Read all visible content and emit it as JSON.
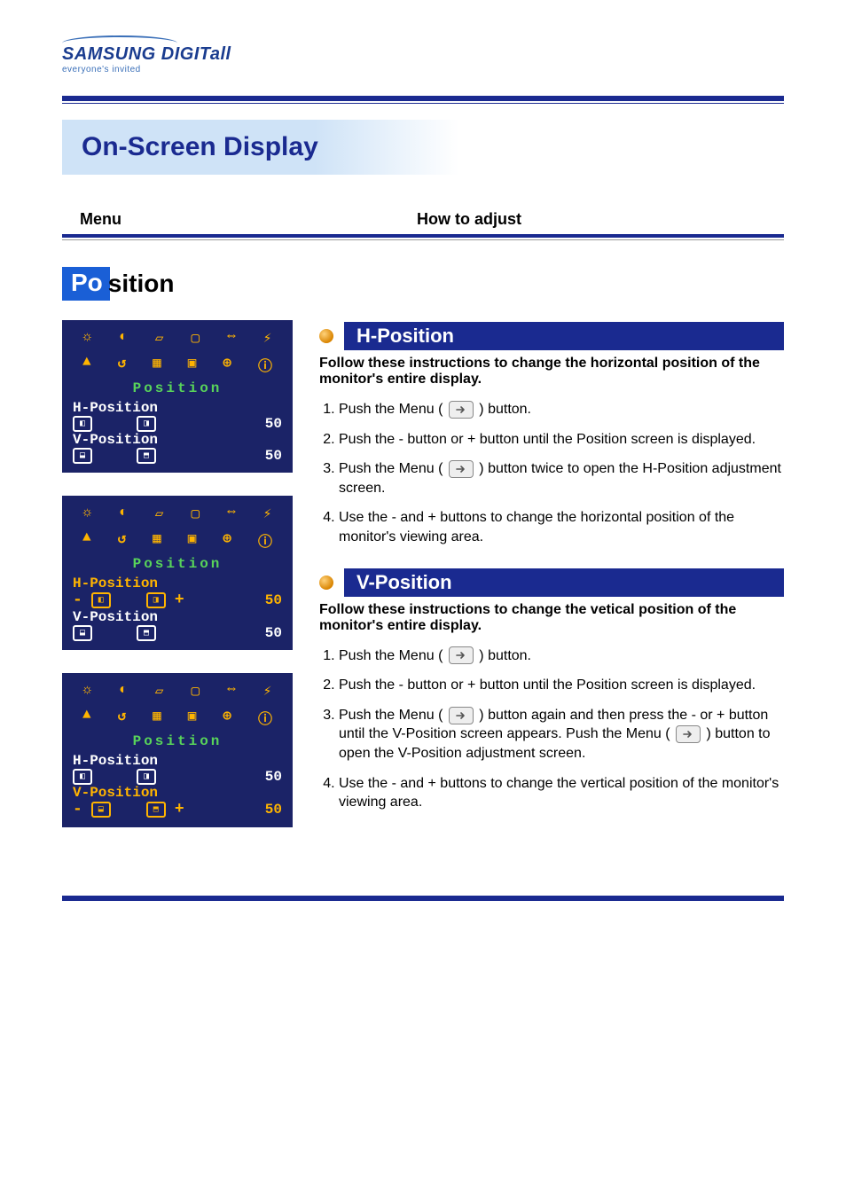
{
  "brand": {
    "name_main": "SAMSUNG DIGIT",
    "name_suffix": "all",
    "tagline": "everyone's invited"
  },
  "page_title": "On-Screen Display",
  "columns": {
    "menu": "Menu",
    "howto": "How to adjust"
  },
  "section": {
    "tab": "Po",
    "rest": "sition"
  },
  "osd": {
    "title": "Position",
    "h_label": "H-Position",
    "v_label": "V-Position",
    "h_value": "50",
    "v_value": "50"
  },
  "hpos": {
    "title": "H-Position",
    "lead": "Follow these instructions to change the horizontal position of the monitor's entire display.",
    "steps": [
      {
        "pre": "Push the Menu ( ",
        "post": " ) button."
      },
      {
        "text": "Push the - button or + button until the Position screen is displayed."
      },
      {
        "pre": "Push the Menu ( ",
        "post": " ) button twice to open the H-Position adjustment screen."
      },
      {
        "text": "Use the - and + buttons to change the horizontal position of the monitor's viewing area."
      }
    ]
  },
  "vpos": {
    "title": "V-Position",
    "lead": "Follow these instructions to change the vetical position of the monitor's entire display.",
    "steps": [
      {
        "pre": "Push the Menu ( ",
        "post": " ) button."
      },
      {
        "text": "Push the - button or + button until the Position screen is displayed."
      },
      {
        "pre": "Push the Menu ( ",
        "mid": " ) button again and then press the - or + button until the V-Position screen appears. Push the Menu ( ",
        "post": " ) button to open the V-Position adjustment screen."
      },
      {
        "text": "Use the - and + buttons to change the vertical position of the monitor's viewing area."
      }
    ]
  }
}
